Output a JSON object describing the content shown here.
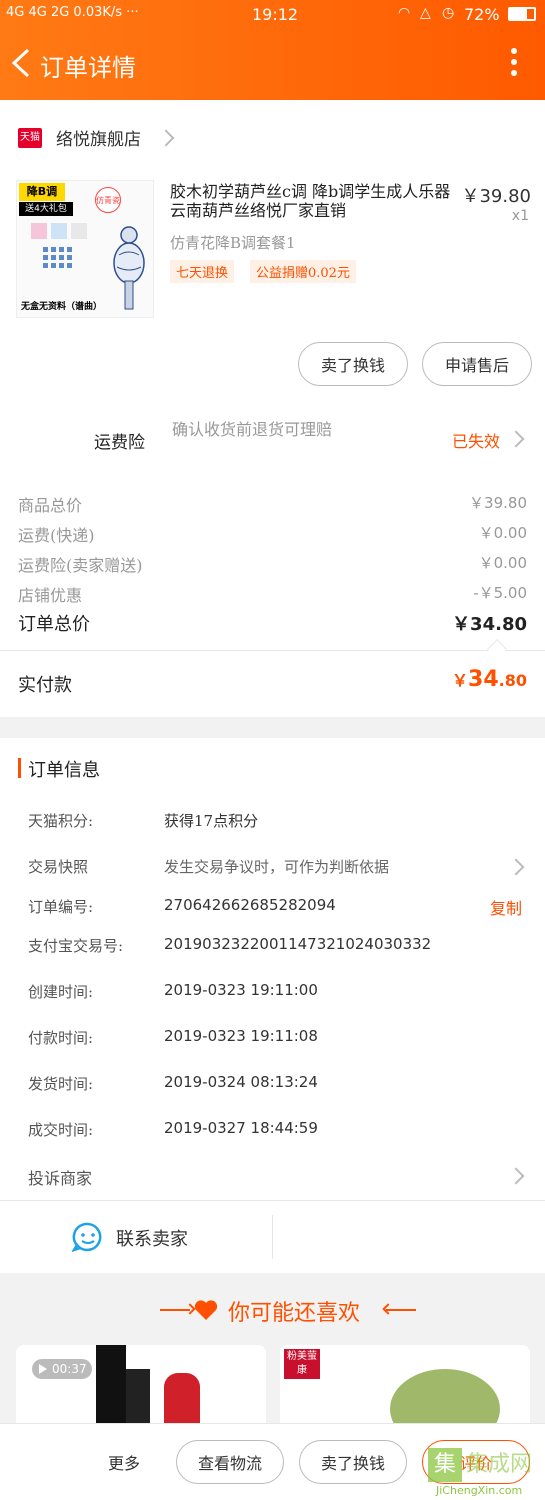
{
  "status_bar": {
    "left": "4G 4G 2G 0.03K/s ···",
    "time": "19:12",
    "battery": "72%"
  },
  "header": {
    "title": "订单详情",
    "back_icon": "chevron-left-icon",
    "more_icon": "more-vertical-icon"
  },
  "store": {
    "badge": "天猫",
    "name": "络悦旗舰店"
  },
  "product": {
    "thumb_label_top": "降B调",
    "thumb_label_sub": "送4大礼包",
    "thumb_label_bottom": "无盒无资料（谱曲）",
    "thumb_stamp": "仿青瓷",
    "title": "胶木初学葫芦丝c调 降b调学生成人乐器云南葫芦丝络悦厂家直销",
    "sku": "仿青花降B调套餐1",
    "price": "￥39.80",
    "qty": "x1",
    "tags": [
      "七天退换",
      "公益捐赠0.02元"
    ]
  },
  "product_actions": {
    "sell_swap": "卖了换钱",
    "after_sale": "申请售后"
  },
  "shipping_insurance": {
    "label": "运费险",
    "desc": "确认收货前退货可理赔",
    "status": "已失效"
  },
  "summary": {
    "rows": [
      {
        "label": "商品总价",
        "value": "￥39.80"
      },
      {
        "label": "运费(快递)",
        "value": "￥0.00"
      },
      {
        "label": "运费险(卖家赠送)",
        "value": "￥0.00"
      },
      {
        "label": "店铺优惠",
        "value": "-￥5.00"
      }
    ],
    "total_label": "订单总价",
    "total_value": "￥34.80",
    "paid_label": "实付款",
    "paid_currency": "￥",
    "paid_int": "34",
    "paid_dec": ".80"
  },
  "order_info": {
    "heading": "订单信息",
    "rows": [
      {
        "label": "天猫积分:",
        "value": "获得17点积分"
      },
      {
        "label": "交易快照",
        "value": "发生交易争议时，可作为判断依据"
      },
      {
        "label": "订单编号:",
        "value": "270642662685282094"
      },
      {
        "label": "支付宝交易号:",
        "value": "2019032322001147321024030332"
      },
      {
        "label": "创建时间:",
        "value": "2019-0323 19:11:00"
      },
      {
        "label": "付款时间:",
        "value": "2019-0323 19:11:08"
      },
      {
        "label": "发货时间:",
        "value": "2019-0324 08:13:24"
      },
      {
        "label": "成交时间:",
        "value": "2019-0327 18:44:59"
      }
    ],
    "copy_label": "复制",
    "complaint": "投诉商家"
  },
  "contact": {
    "label": "联系卖家"
  },
  "recommend": {
    "heading": "你可能还喜欢",
    "video_time": "00:37",
    "brand_tag": "粉美萤康"
  },
  "bottom_bar": {
    "more": "更多",
    "logistics": "查看物流",
    "sell_swap": "卖了换钱",
    "review": "评价"
  },
  "watermark": {
    "text": "JiChengXin.com",
    "brand": "集成网"
  },
  "colors": {
    "accent": "#ff5000",
    "header_start": "#ff7a14",
    "header_end": "#ff5a00"
  }
}
